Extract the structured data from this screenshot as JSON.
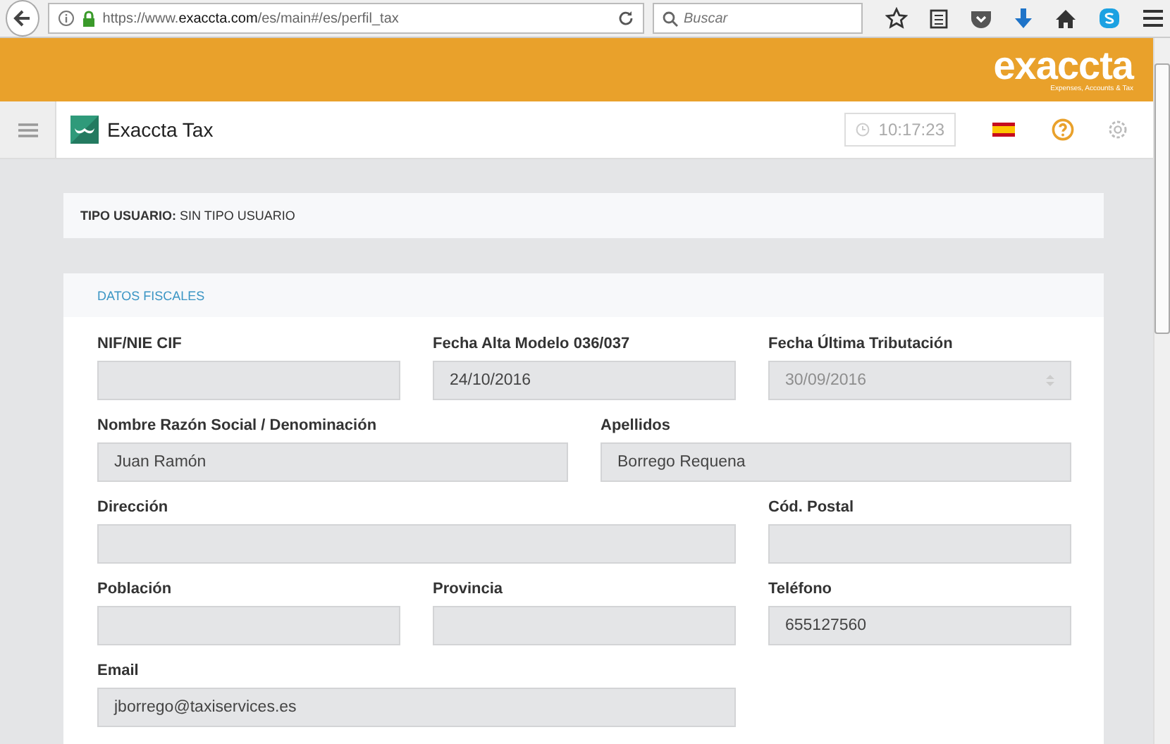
{
  "browser": {
    "url": "https://www.**exaccta.com**/es/main#/es/perfil_tax",
    "search": {
      "placeholder": "Buscar"
    }
  },
  "header": {
    "logo": "exaccta",
    "tagline": "Expenses, Accounts & Tax"
  },
  "app_bar": {
    "title": "Exaccta Tax",
    "time": "10:17:23"
  },
  "user_type": {
    "label": "TIPO USUARIO:",
    "value": "SIN TIPO USUARIO"
  },
  "section": {
    "title": "DATOS FISCALES",
    "fields": [
      {
        "label": "NIF/NIE CIF",
        "kind": "text"
      },
      {
        "label": "Fecha Alta Modelo 036/037",
        "value": "24/10/2016",
        "kind": "text"
      },
      {
        "label": "Fecha Última Tributación",
        "value": "30/09/2016",
        "kind": "select"
      },
      {
        "label": "Nombre Razón Social / Denominación",
        "value": "Juan Ramón",
        "kind": "text"
      },
      {
        "label": "Apellidos",
        "value": "Borrego Requena",
        "kind": "text"
      },
      {
        "label": "Dirección",
        "kind": "text"
      },
      {
        "label": "Cód. Postal",
        "kind": "text"
      },
      {
        "label": "Población",
        "kind": "text"
      },
      {
        "label": "Provincia",
        "kind": "text"
      },
      {
        "label": "Teléfono",
        "value": "655127560",
        "kind": "text"
      },
      {
        "label": "Email",
        "value": "jborrego@taxiservices.es",
        "kind": "text"
      }
    ]
  }
}
